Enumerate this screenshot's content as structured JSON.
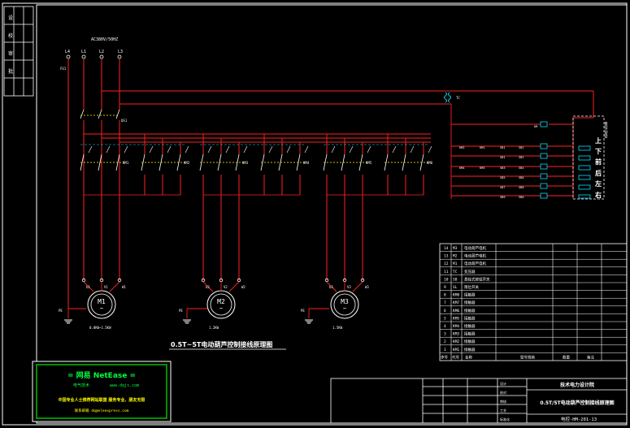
{
  "diagram": {
    "title": "0.5T~5T电动葫芦控制接线原理图",
    "supply": "AC380V/50HZ",
    "phases": [
      "L1",
      "L2",
      "L3"
    ],
    "phase_l4": "L4",
    "fuse": "FU1",
    "breaker": "QS1",
    "transformer": "TC",
    "contactors": [
      "KM1",
      "KM2",
      "KM3",
      "KM4",
      "KM5",
      "KM6",
      "KM7",
      "KM8"
    ],
    "motors": [
      {
        "name": "M1",
        "terminals": [
          "U1",
          "V1",
          "W1"
        ],
        "rating": "0.8KW~1.5KW"
      },
      {
        "name": "M2",
        "terminals": [
          "U2",
          "V2",
          "W2"
        ],
        "rating": "1.2KW"
      },
      {
        "name": "M3",
        "terminals": [
          "U3",
          "V3",
          "W3"
        ],
        "rating": "1.5KW"
      }
    ],
    "ground": "PE",
    "pendant_labels": [
      "上",
      "下",
      "前",
      "后",
      "左",
      "右"
    ],
    "pendant_title": "悬挂式按钮"
  },
  "logo": {
    "line1": "= 网易 NetEase =",
    "line2": "电气技术",
    "line3": "www.dqjs.com",
    "line4": "中国专业人士推荐网站联盟  服务专业、朋友无限",
    "line5": "联系邮箱  dq@eleexpress.com"
  },
  "parts_table": {
    "rows": [
      {
        "no": "1",
        "code": "KM1",
        "name": "接触器"
      },
      {
        "no": "2",
        "code": "KM2",
        "name": "接触器"
      },
      {
        "no": "3",
        "code": "KM3",
        "name": "接触器"
      },
      {
        "no": "4",
        "code": "KM4",
        "name": "接触器"
      },
      {
        "no": "5",
        "code": "KM5",
        "name": "接触器"
      },
      {
        "no": "6",
        "code": "KM6",
        "name": "接触器"
      },
      {
        "no": "7",
        "code": "KM7",
        "name": "接触器"
      },
      {
        "no": "8",
        "code": "KM8",
        "name": "接触器"
      },
      {
        "no": "9",
        "code": "SL",
        "name": "限位开关"
      },
      {
        "no": "10",
        "code": "SB",
        "name": "悬挂式按钮开关"
      },
      {
        "no": "11",
        "code": "TC",
        "name": "变压器"
      },
      {
        "no": "12",
        "code": "M1",
        "name": "电动葫芦电机"
      },
      {
        "no": "13",
        "code": "M2",
        "name": "电动葫芦电机"
      },
      {
        "no": "14",
        "code": "M3",
        "name": "电动葫芦电机"
      }
    ],
    "header": [
      "序号",
      "代号",
      "名称",
      "型号规格",
      "数量",
      "备注"
    ]
  },
  "title_block": {
    "company": "技术电力设计院",
    "drawing_title": "0.5T/5T电动葫芦控制接线原理图",
    "drawing_no": "电控-HM-201-13",
    "labels": [
      "设计",
      "校对",
      "审核",
      "工艺",
      "标准化",
      "批准"
    ]
  },
  "colors": {
    "wire": "#ff2020",
    "frame": "#ffffff",
    "dashed": "#ffff00",
    "motor": "#ffffff",
    "component": "#00e0ff",
    "logo_box": "#00c000"
  }
}
